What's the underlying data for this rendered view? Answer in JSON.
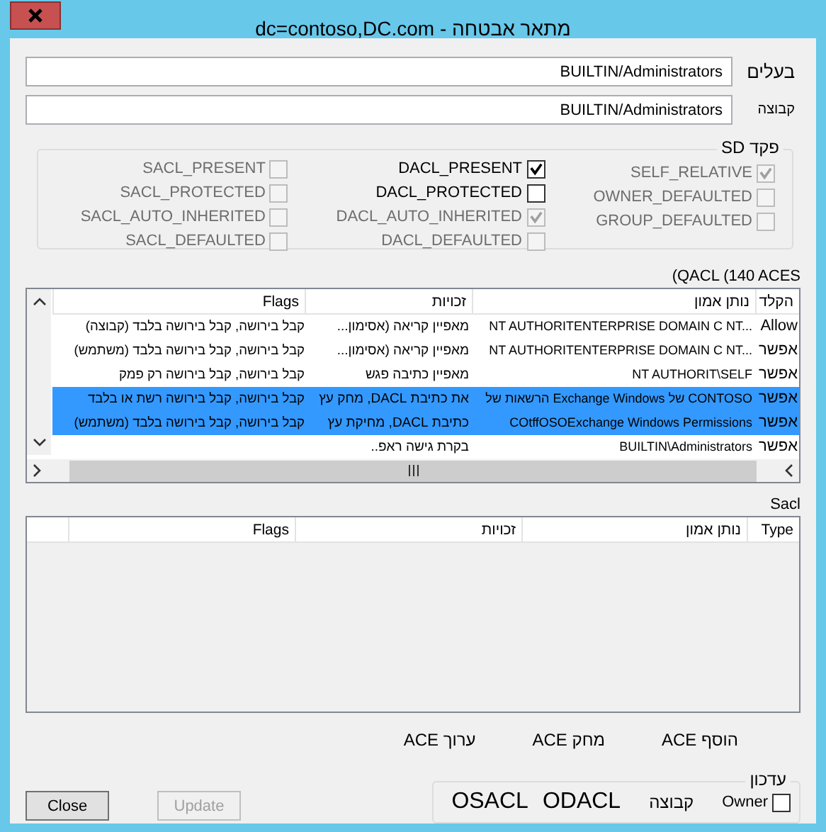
{
  "window": {
    "title": "dc=contoso,DC.com - מתאר אבטחה"
  },
  "owner": {
    "label": "בעלים",
    "value": "BUILTIN/Administrators"
  },
  "group": {
    "label": "קבוצה",
    "value": "BUILTIN/Administrators"
  },
  "sd_control": {
    "label": "פקד SD",
    "columns": [
      {
        "items": [
          {
            "label": "SELF_RELATIVE",
            "checked": true,
            "disabled": true
          },
          {
            "label": "OWNER_DEFAULTED",
            "checked": false,
            "disabled": true
          },
          {
            "label": "GROUP_DEFAULTED",
            "checked": false,
            "disabled": true
          }
        ]
      },
      {
        "items": [
          {
            "label": "DACL_PRESENT",
            "checked": true,
            "disabled": false
          },
          {
            "label": "DACL_PROTECTED",
            "checked": false,
            "disabled": false
          },
          {
            "label": "DACL_AUTO_INHERITED",
            "checked": true,
            "disabled": true
          },
          {
            "label": "DACL_DEFAULTED",
            "checked": false,
            "disabled": true
          }
        ]
      },
      {
        "items": [
          {
            "label": "SACL_PRESENT",
            "checked": false,
            "disabled": true
          },
          {
            "label": "SACL_PROTECTED",
            "checked": false,
            "disabled": true
          },
          {
            "label": "SACL_AUTO_INHERITED",
            "checked": false,
            "disabled": true
          },
          {
            "label": "SACL_DEFAULTED",
            "checked": false,
            "disabled": true
          }
        ]
      }
    ]
  },
  "dacl": {
    "label": "(QACL (140 ACES",
    "columns": [
      "הקלד",
      "נותן אמון",
      "זכויות",
      "Flags"
    ],
    "rows": [
      {
        "cells": [
          "Allow",
          "NT AUTHORITENTERPRISE DOMAIN C NT...",
          "מאפיין קריאה (אסימון...",
          "קבל בירושה, קבל בירושה בלבד (קבוצה)"
        ],
        "selected": false
      },
      {
        "cells": [
          "אפשר",
          "NT AUTHORITENTERPRISE DOMAIN C NT...",
          "מאפיין קריאה (אסימון...",
          "קבל בירושה, קבל בירושה בלבד (משתמש)"
        ],
        "selected": false
      },
      {
        "cells": [
          "אפשר",
          "NT AUTHORIT\\SELF",
          "מאפיין כתיבה פגש",
          "קבל בירושה, קבל בירושה רק פמק"
        ],
        "selected": false
      },
      {
        "cells": [
          "אפשר",
          "הרשאות של Exchange Windows של CONTOSO",
          "את כתיבת DACL, מחק עץ",
          "קבל בירושה, קבל בירושה רשת או בלבד"
        ],
        "selected": true
      },
      {
        "cells": [
          "אפשר",
          "COtffOSOExchange Windows Permissions",
          "כתיבת DACL, מחיקת עץ",
          "קבל בירושה, קבל בירושה בלבד (משתמש)"
        ],
        "selected": true
      },
      {
        "cells": [
          "אפשר",
          "BUILTIN\\Administrators",
          "בקרת גישה ראפ..",
          ""
        ],
        "selected": false
      }
    ]
  },
  "sacl": {
    "label": "Sacl",
    "columns": [
      "Type",
      "נותן אמון",
      "זכויות",
      "Flags"
    ]
  },
  "ace_buttons": [
    "הוסף ACE",
    "מחק ACE",
    "ערוך ACE"
  ],
  "update": {
    "label": "עדכון",
    "items": [
      {
        "kind": "checkbox",
        "label": "Owner",
        "checked": false
      },
      {
        "kind": "text",
        "label": "קבוצה"
      },
      {
        "kind": "big",
        "label": "ODACL"
      },
      {
        "kind": "big",
        "label": "OSACL"
      }
    ]
  },
  "buttons": [
    {
      "label": "Update",
      "disabled": true
    },
    {
      "label": "Close",
      "disabled": false
    }
  ]
}
